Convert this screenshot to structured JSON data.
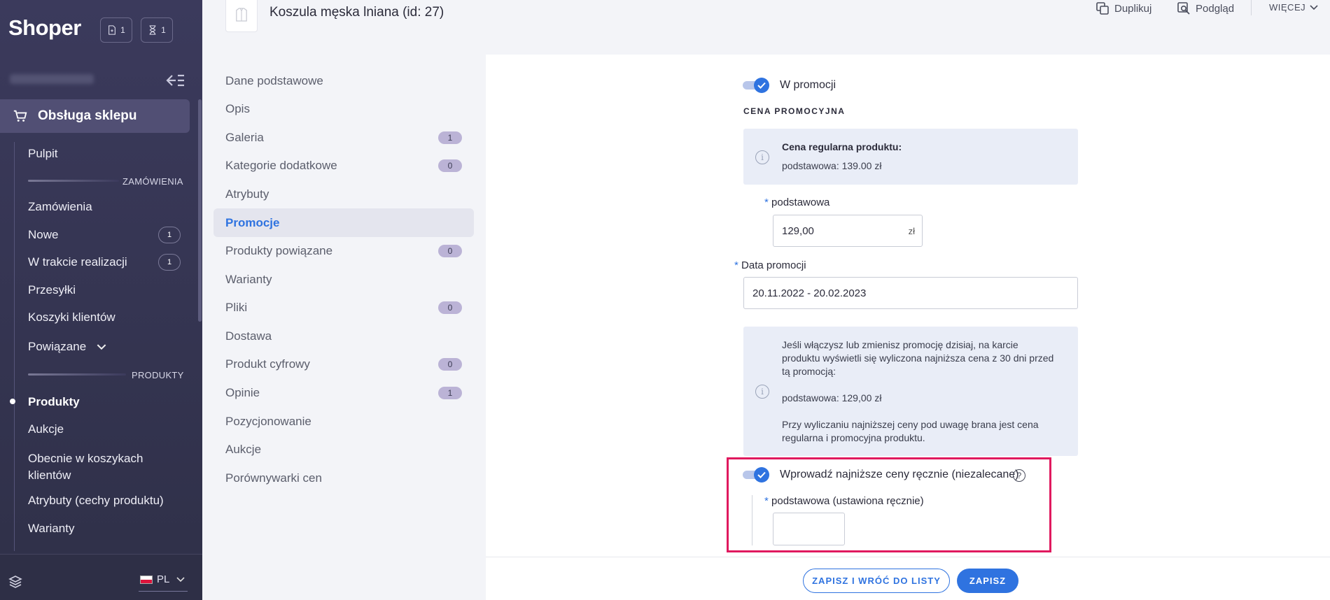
{
  "sidebar": {
    "logo": "Shoper",
    "badges": [
      {
        "icon": "document-icon",
        "count": "1"
      },
      {
        "icon": "hourglass-icon",
        "count": "1"
      }
    ],
    "active_section": "Obsługa sklepu",
    "items": {
      "pulpit": "Pulpit",
      "section_orders": "ZAMÓWIENIA",
      "zamowienia": "Zamówienia",
      "nowe": "Nowe",
      "nowe_count": "1",
      "w_trakcie": "W trakcie realizacji",
      "w_trakcie_count": "1",
      "przesylki": "Przesyłki",
      "koszyki": "Koszyki klientów",
      "powiazane": "Powiązane",
      "section_products": "PRODUKTY",
      "produkty": "Produkty",
      "aukcje": "Aukcje",
      "obecnie_l1": "Obecnie w koszykach",
      "obecnie_l2": "klientów",
      "atrybuty": "Atrybuty (cechy produktu)",
      "warianty": "Warianty"
    },
    "language": "PL"
  },
  "header": {
    "title": "Koszula męska lniana (id: 27)",
    "actions": {
      "duplicate": "Duplikuj",
      "preview": "Podgląd",
      "more": "WIĘCEJ"
    }
  },
  "section_menu": [
    {
      "label": "Dane podstawowe",
      "badge": ""
    },
    {
      "label": "Opis",
      "badge": ""
    },
    {
      "label": "Galeria",
      "badge": "1"
    },
    {
      "label": "Kategorie dodatkowe",
      "badge": "0"
    },
    {
      "label": "Atrybuty",
      "badge": ""
    },
    {
      "label": "Promocje",
      "badge": "",
      "active": true
    },
    {
      "label": "Produkty powiązane",
      "badge": "0"
    },
    {
      "label": "Warianty",
      "badge": ""
    },
    {
      "label": "Pliki",
      "badge": "0"
    },
    {
      "label": "Dostawa",
      "badge": ""
    },
    {
      "label": "Produkt cyfrowy",
      "badge": "0"
    },
    {
      "label": "Opinie",
      "badge": "1"
    },
    {
      "label": "Pozycjonowanie",
      "badge": ""
    },
    {
      "label": "Aukcje",
      "badge": ""
    },
    {
      "label": "Porównywarki cen",
      "badge": ""
    }
  ],
  "promo": {
    "toggle_label": "W promocji",
    "toggle_on": true,
    "section_title": "CENA PROMOCYJNA",
    "regular_title": "Cena regularna produktu:",
    "regular_value": "podstawowa: 139.00 zł",
    "price_label": "podstawowa",
    "price_value": "129,00",
    "currency": "zł",
    "date_label": "Data promocji",
    "date_value": "20.11.2022 - 20.02.2023",
    "info_l1": "Jeśli włączysz lub zmienisz promocję dzisiaj, na karcie",
    "info_l2": "produktu wyświetli się wyliczona najniższa cena z 30 dni przed",
    "info_l3": "tą promocją:",
    "info_value": "podstawowa: 129,00 zł",
    "info_note_l1": "Przy wyliczaniu najniższej ceny pod uwagę brana jest cena",
    "info_note_l2": "regularna i promocyjna produktu.",
    "manual_toggle_label": "Wprowadź najniższe ceny ręcznie (niezalecane)",
    "manual_toggle_on": true,
    "manual_price_label": "podstawowa (ustawiona ręcznie)",
    "manual_price_value": "",
    "required_mark": "*",
    "info_mark": "i",
    "help_mark": "?"
  },
  "footer": {
    "save_back": "ZAPISZ I WRÓĆ DO LISTY",
    "save": "ZAPISZ"
  },
  "colors": {
    "accent": "#2f73e0",
    "sidebar": "#3b3a5c",
    "highlight": "#e0195e"
  }
}
